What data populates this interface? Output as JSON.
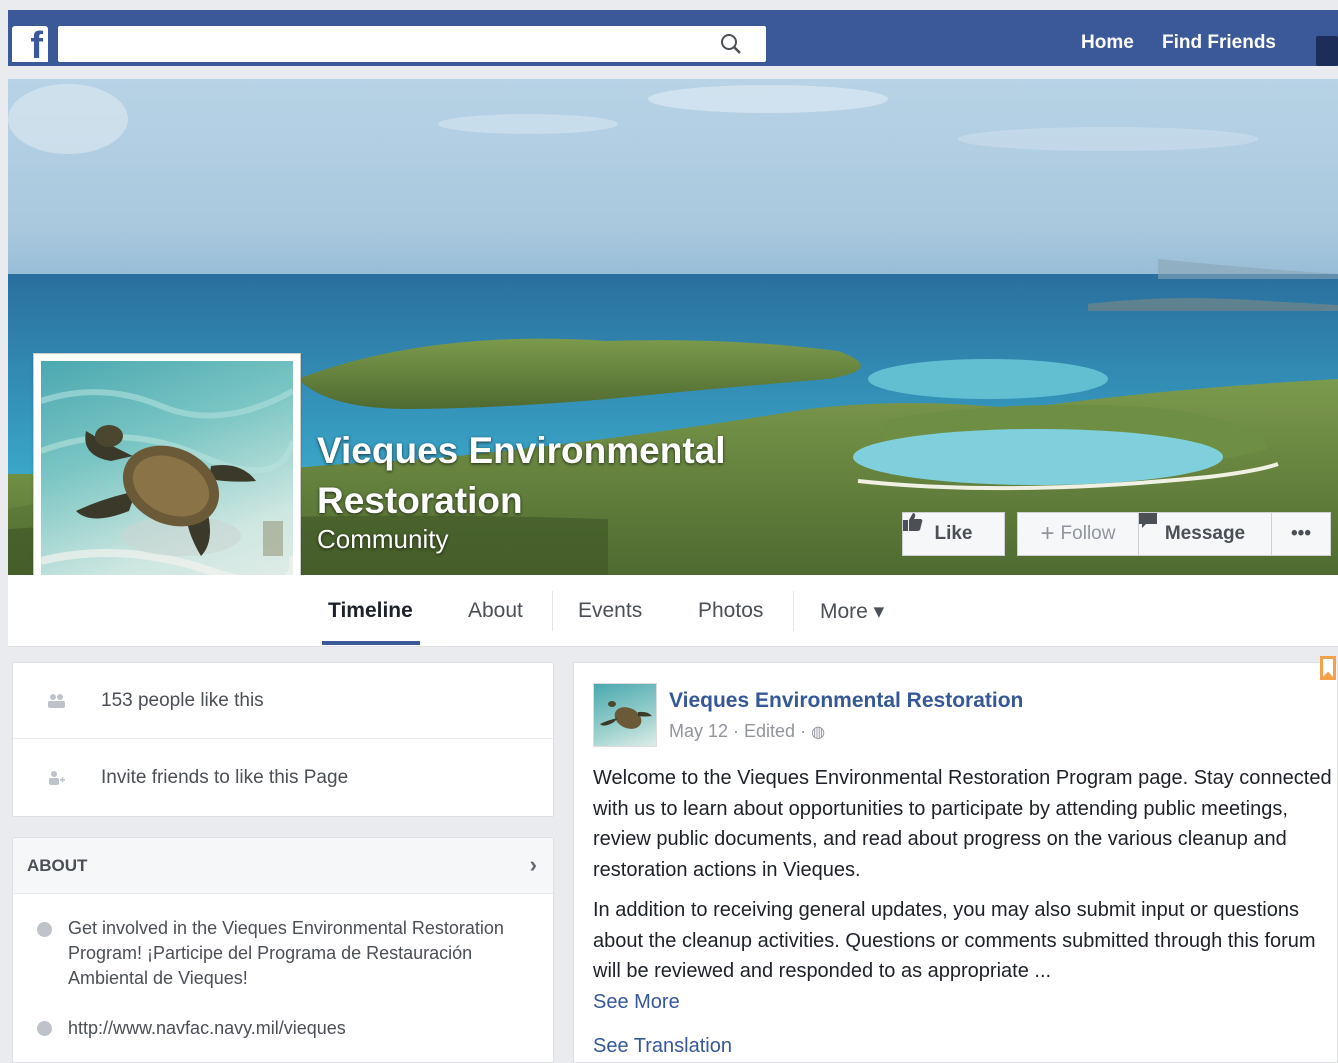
{
  "topbar": {
    "logo": "f",
    "search_placeholder": "",
    "nav": {
      "home": "Home",
      "find_friends": "Find Friends"
    }
  },
  "page": {
    "name": "Vieques Environmental Restoration",
    "category": "Community"
  },
  "cover_buttons": {
    "like": "Like",
    "follow": "Follow",
    "message": "Message",
    "more": "•••"
  },
  "tabs": [
    "Timeline",
    "About",
    "Events",
    "Photos",
    "More ▾"
  ],
  "sidebar": {
    "likes": "153 people like this",
    "invite": "Invite friends to like this Page",
    "about_heading": "ABOUT",
    "about_text": "Get involved in the Vieques Environmental Restoration Program! ¡Participe del Programa de Restauración Ambiental de Vieques!",
    "website": "http://www.navfac.navy.mil/vieques"
  },
  "post": {
    "author": "Vieques Environmental Restoration",
    "meta": "May 12 · Edited · ",
    "paragraph1": "Welcome to the Vieques Environmental Restoration Program page. Stay connected with us to learn about opportunities to participate by attending public meetings, review public documents, and read about progress on the various cleanup and restoration actions in Vieques.",
    "paragraph2": "In addition to receiving general updates, you may also submit input or questions about the cleanup activities. Questions or comments submitted through this forum will be reviewed and responded to as appropriate ...",
    "see_more": "See More",
    "see_translation": "See Translation"
  },
  "colors": {
    "brand": "#3b5998",
    "link": "#365899",
    "accent_bookmark": "#f5a04a"
  }
}
